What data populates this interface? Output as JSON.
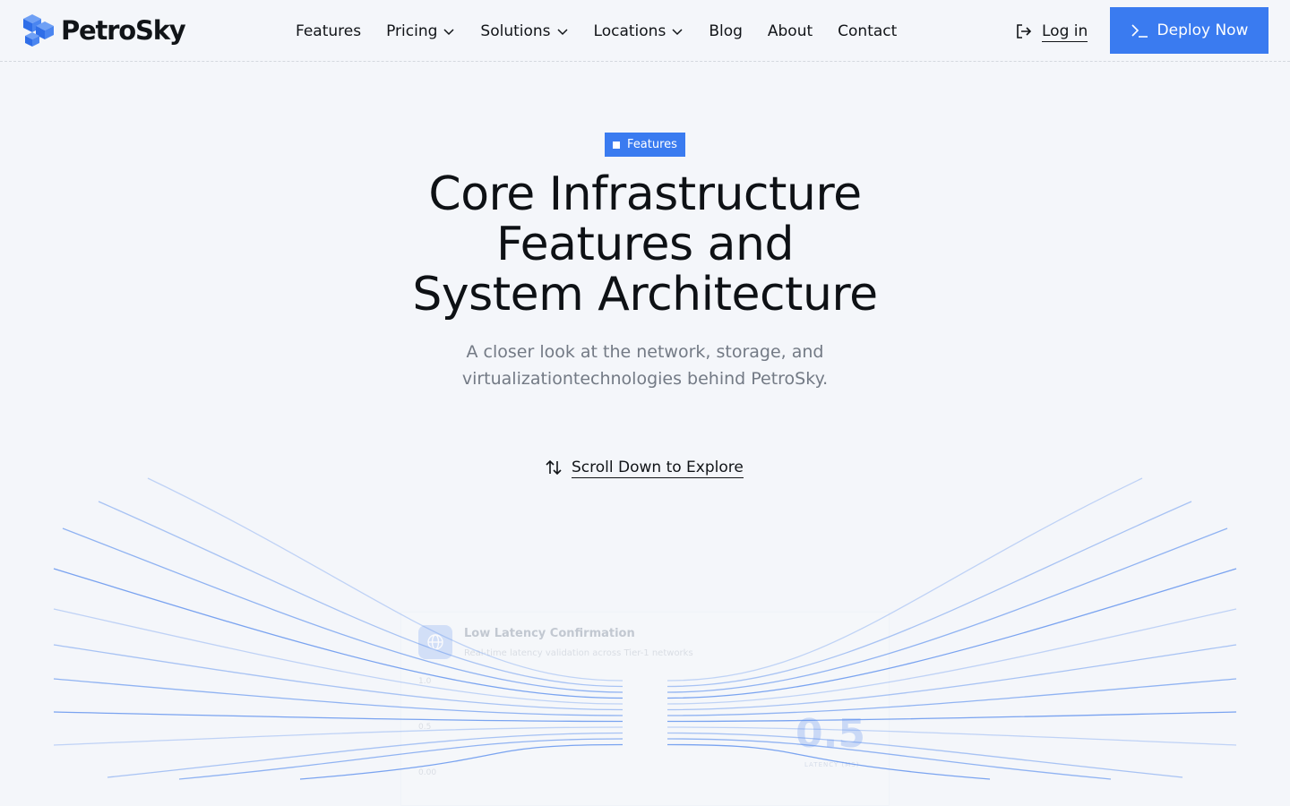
{
  "brand": {
    "name": "PetroSky",
    "accent": "#3a7bf0"
  },
  "nav": {
    "items": [
      {
        "label": "Features",
        "dropdown": false
      },
      {
        "label": "Pricing",
        "dropdown": true
      },
      {
        "label": "Solutions",
        "dropdown": true
      },
      {
        "label": "Locations",
        "dropdown": true
      },
      {
        "label": "Blog",
        "dropdown": false
      },
      {
        "label": "About",
        "dropdown": false
      },
      {
        "label": "Contact",
        "dropdown": false
      }
    ],
    "login_label": "Log in",
    "deploy_label": "Deploy Now"
  },
  "hero": {
    "badge": "Features",
    "title_lines": [
      "Core Infrastructure",
      "Features and",
      "System Architecture"
    ],
    "subtitle_lines": [
      "A closer look at the network, storage, and",
      "virtualizationtechnologies behind PetroSky."
    ],
    "scroll_label": "Scroll Down to Explore"
  },
  "card": {
    "title": "Low Latency Confirmation",
    "description": "Real-time latency validation across Tier-1 networks",
    "ticks": [
      "1.0",
      "0.5",
      "0.00"
    ],
    "metric_value": "0.5",
    "metric_label": "LATENCY (MS)"
  }
}
